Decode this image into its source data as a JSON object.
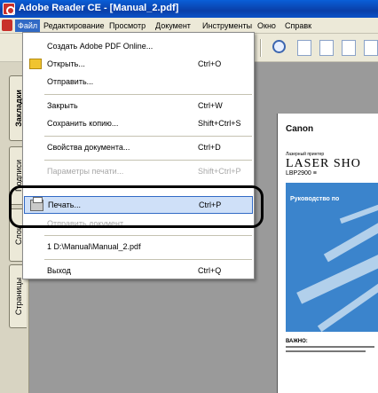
{
  "window": {
    "title": "Adobe Reader CE - [Manual_2.pdf]"
  },
  "menubar": {
    "items": [
      "Файл",
      "Редактирование",
      "Просмотр",
      "Документ",
      "Инструменты",
      "Окно",
      "Справк"
    ]
  },
  "file_menu": {
    "items": [
      {
        "label": "Создать Adobe PDF Online...",
        "shortcut": "",
        "enabled": true
      },
      {
        "label": "Открыть...",
        "shortcut": "Ctrl+O",
        "enabled": true,
        "icon": "open-folder-icon"
      },
      {
        "label": "Отправить...",
        "shortcut": "",
        "enabled": true
      },
      {
        "label": "Закрыть",
        "shortcut": "Ctrl+W",
        "enabled": true
      },
      {
        "label": "Сохранить копию...",
        "shortcut": "Shift+Ctrl+S",
        "enabled": true
      },
      {
        "label": "Свойства документа...",
        "shortcut": "Ctrl+D",
        "enabled": true
      },
      {
        "label": "Параметры печати...",
        "shortcut": "Shift+Ctrl+P",
        "enabled": false
      },
      {
        "label": "Печать...",
        "shortcut": "Ctrl+P",
        "enabled": true,
        "highlighted": true,
        "icon": "printer-icon"
      },
      {
        "label": "Отправить документ...",
        "shortcut": "",
        "enabled": false
      },
      {
        "label": "1 D:\\Manual\\Manual_2.pdf",
        "shortcut": "",
        "enabled": true
      },
      {
        "label": "Выход",
        "shortcut": "Ctrl+Q",
        "enabled": true
      }
    ]
  },
  "side_tabs": [
    "Закладки",
    "Подписи",
    "Слои",
    "Страницы"
  ],
  "document": {
    "brand": "Canon",
    "product_type": "Лазерный принтер",
    "product": "LASER SHO",
    "model": "LBP2900 ≡",
    "section_title": "Руководство по",
    "notice_label": "ВАЖНО:"
  },
  "colors": {
    "titlebar": "#0a4fc8",
    "highlight": "#cfe0f8",
    "doc_block": "#3b84cc"
  }
}
